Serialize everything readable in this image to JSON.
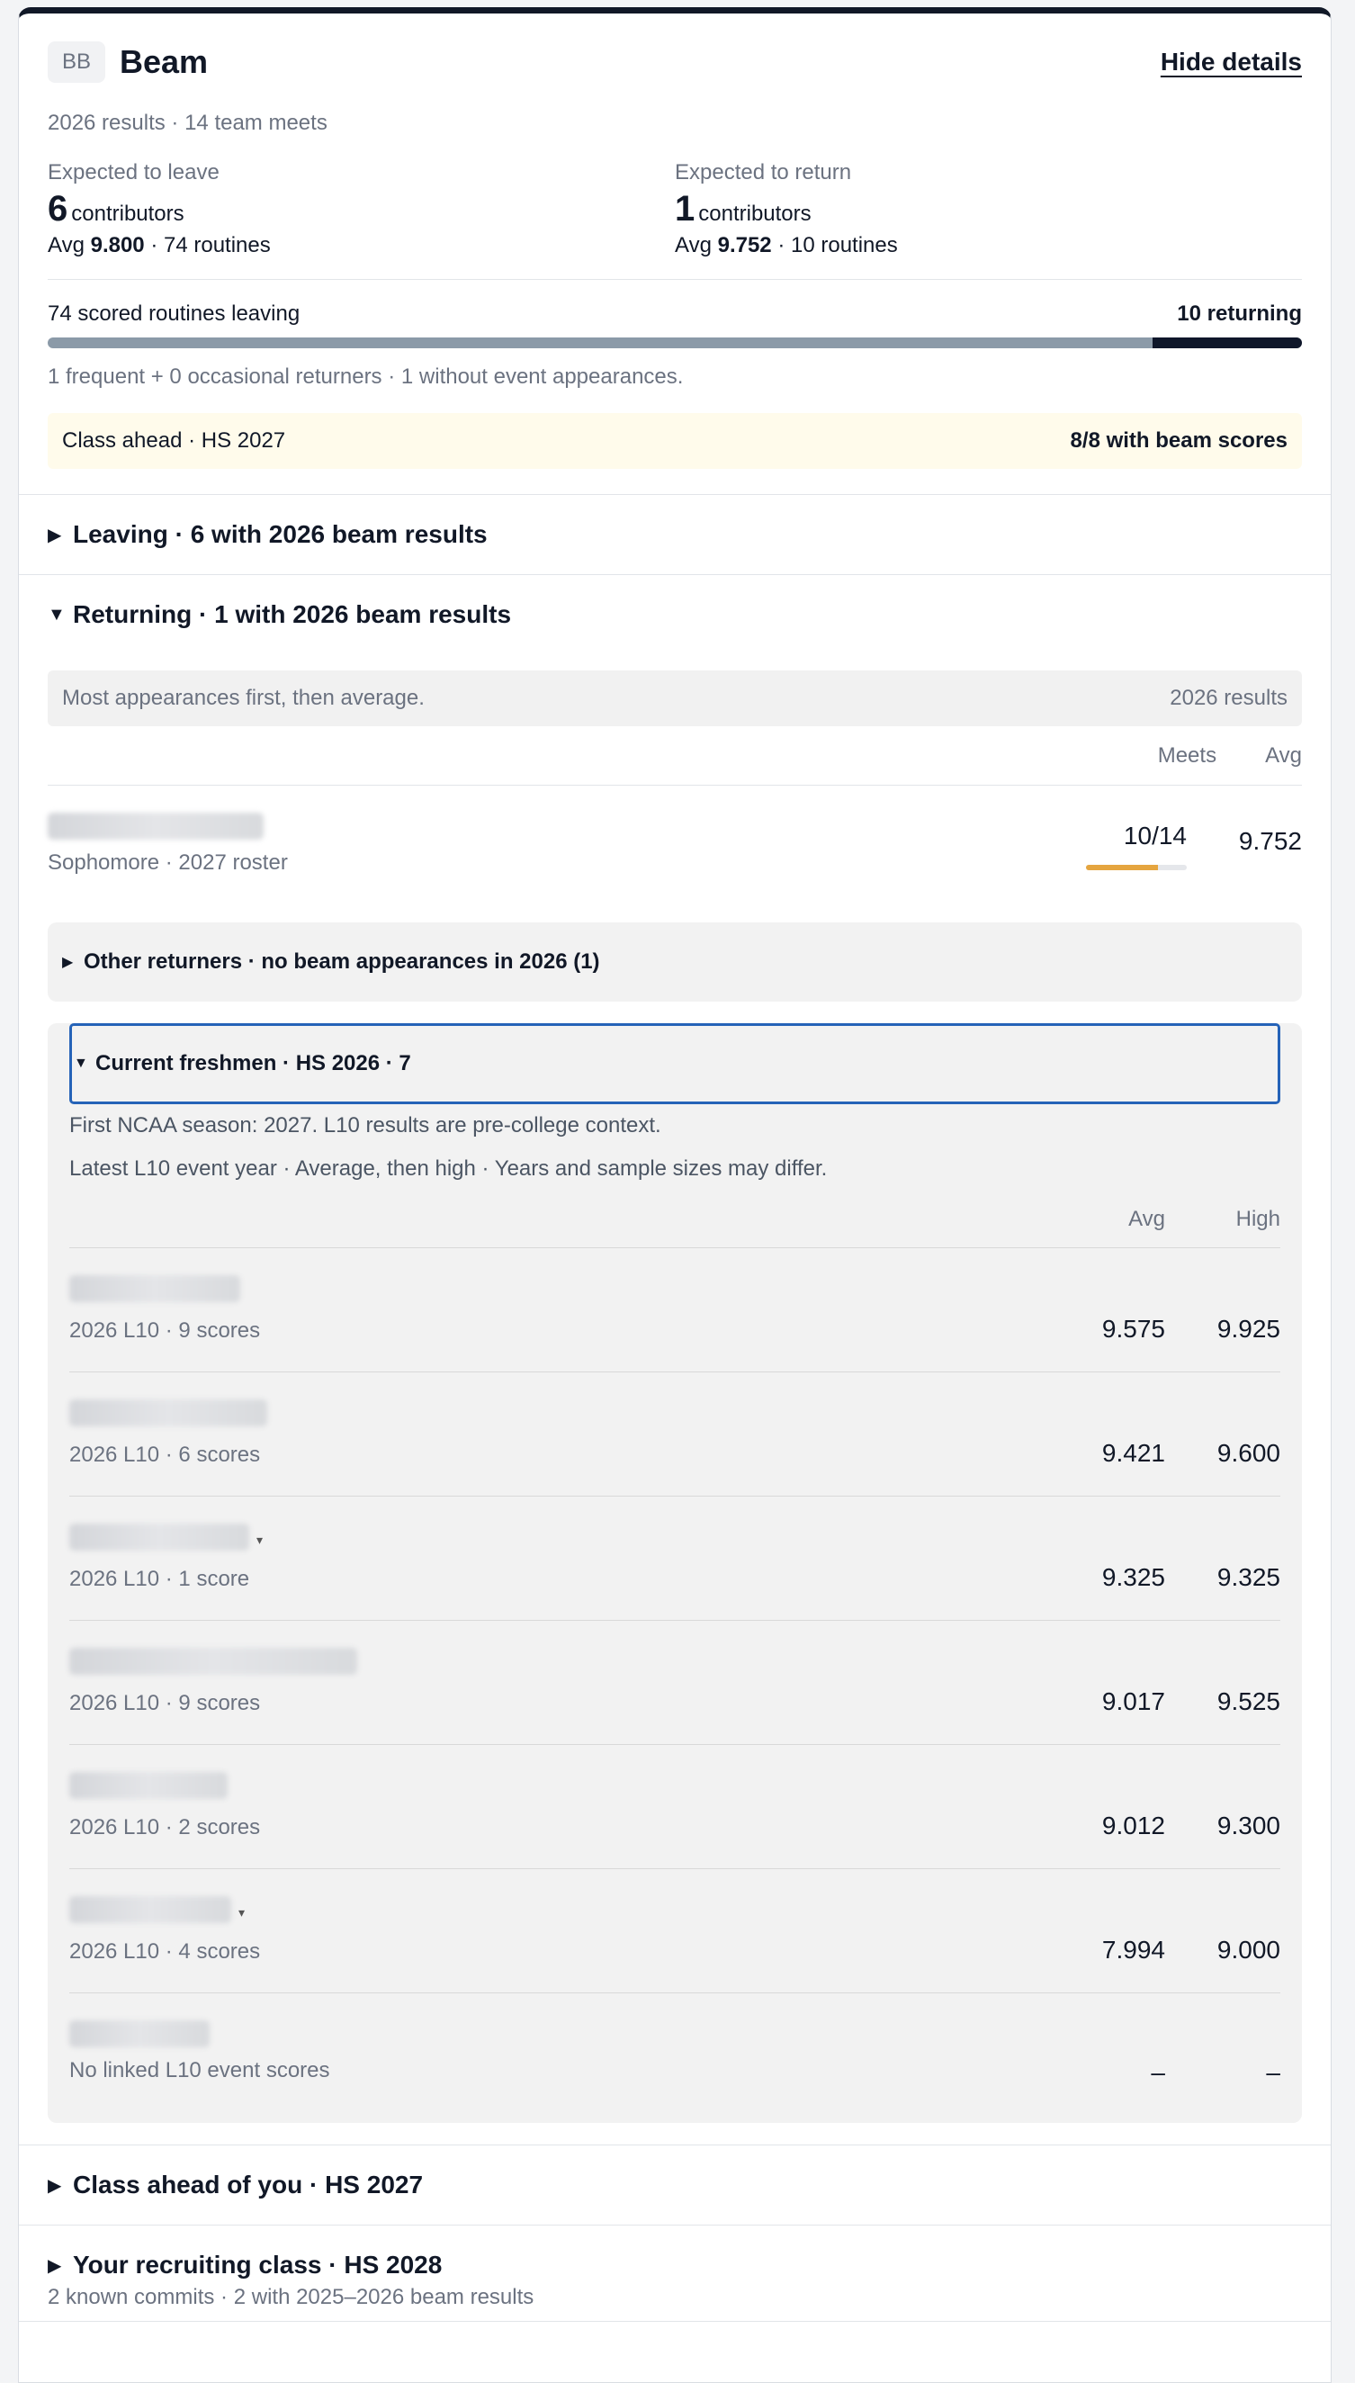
{
  "header": {
    "badge": "BB",
    "title": "Beam",
    "hide_label": "Hide details",
    "subtitle": "2026 results · 14 team meets"
  },
  "leave": {
    "label": "Expected to leave",
    "count": "6",
    "unit": "contributors",
    "avg_prefix": "Avg",
    "avg": "9.800",
    "routines": "· 74 routines"
  },
  "return": {
    "label": "Expected to return",
    "count": "1",
    "unit": "contributors",
    "avg_prefix": "Avg",
    "avg": "9.752",
    "routines": "· 10 routines"
  },
  "routines_bar": {
    "left": "74 scored routines leaving",
    "right": "10 returning",
    "returning_fraction": 0.119,
    "note": "1 frequent + 0 occasional returners · 1 without event appearances."
  },
  "class_ahead_box": {
    "left": "Class ahead · HS 2027",
    "right": "8/8 with beam scores"
  },
  "leaving_section": {
    "arrow": "▶",
    "label": "Leaving · 6 with 2026 beam results"
  },
  "returning_section": {
    "arrow": "▼",
    "label": "Returning · 1 with 2026 beam results",
    "sort_note": "Most appearances first, then average.",
    "results_label": "2026 results",
    "col_meets": "Meets",
    "col_avg": "Avg",
    "rows": [
      {
        "sub": "Sophomore · 2027 roster",
        "meets": "10/14",
        "meets_fraction": 0.714,
        "avg": "9.752"
      }
    ]
  },
  "other_returners": {
    "arrow": "▶",
    "label": "Other returners · no beam appearances in 2026 (1)"
  },
  "freshmen": {
    "arrow": "▼",
    "label": "Current freshmen · HS 2026 · 7",
    "note1": "First NCAA season: 2027. L10 results are pre-college context.",
    "note2": "Latest L10 event year · Average, then high · Years and sample sizes may differ.",
    "col_avg": "Avg",
    "col_high": "High",
    "rows": [
      {
        "sub": "2026 L10 · 9 scores",
        "avg": "9.575",
        "high": "9.925"
      },
      {
        "sub": "2026 L10 · 6 scores",
        "avg": "9.421",
        "high": "9.600"
      },
      {
        "sub": "2026 L10 · 1 score",
        "avg": "9.325",
        "high": "9.325",
        "caret": "▾"
      },
      {
        "sub": "2026 L10 · 9 scores",
        "avg": "9.017",
        "high": "9.525"
      },
      {
        "sub": "2026 L10 · 2 scores",
        "avg": "9.012",
        "high": "9.300"
      },
      {
        "sub": "2026 L10 · 4 scores",
        "avg": "7.994",
        "high": "9.000",
        "caret": "▾"
      },
      {
        "sub": "No linked L10 event scores",
        "avg": "–",
        "high": "–"
      }
    ]
  },
  "class_ahead_section": {
    "arrow": "▶",
    "label": "Class ahead of you · HS 2027"
  },
  "recruiting_section": {
    "arrow": "▶",
    "label": "Your recruiting class · HS 2028",
    "sub": "2 known commits · 2 with 2025–2026 beam results"
  },
  "colors": {
    "accent_dark": "#0f172a",
    "bar_gray": "#8b9aa8",
    "meter_orange": "#e5a53f",
    "focus_blue": "#2563b8",
    "highlight_bg": "#fffbeb"
  }
}
